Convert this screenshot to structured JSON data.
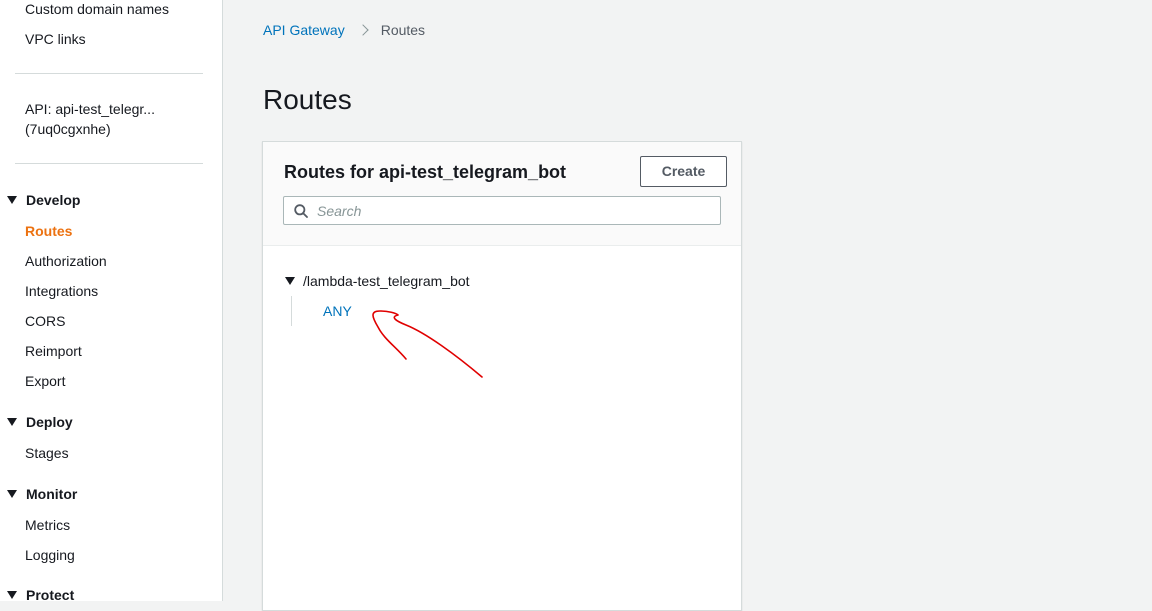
{
  "sidebar": {
    "top_links": [
      {
        "label": "Custom domain names"
      },
      {
        "label": "VPC links"
      }
    ],
    "api_name_line1": "API: api-test_telegr...",
    "api_name_line2": "(7uq0cgxnhe)",
    "sections": [
      {
        "title": "Develop",
        "items": [
          "Routes",
          "Authorization",
          "Integrations",
          "CORS",
          "Reimport",
          "Export"
        ],
        "active": "Routes"
      },
      {
        "title": "Deploy",
        "items": [
          "Stages"
        ]
      },
      {
        "title": "Monitor",
        "items": [
          "Metrics",
          "Logging"
        ]
      },
      {
        "title": "Protect",
        "items": []
      }
    ]
  },
  "breadcrumb": {
    "root": "API Gateway",
    "current": "Routes"
  },
  "page": {
    "title": "Routes"
  },
  "panel": {
    "title": "Routes for api-test_telegram_bot",
    "create_label": "Create",
    "search_placeholder": "Search",
    "search_value": "",
    "routes": [
      {
        "path": "/lambda-test_telegram_bot",
        "methods": [
          "ANY"
        ]
      }
    ]
  },
  "colors": {
    "accent_active": "#ec7211",
    "link": "#0073bb",
    "annotation": "#e00000"
  },
  "icons": {
    "search": "search-icon",
    "expand": "caret-down-icon",
    "breadcrumb_separator": "chevron-right-icon"
  }
}
